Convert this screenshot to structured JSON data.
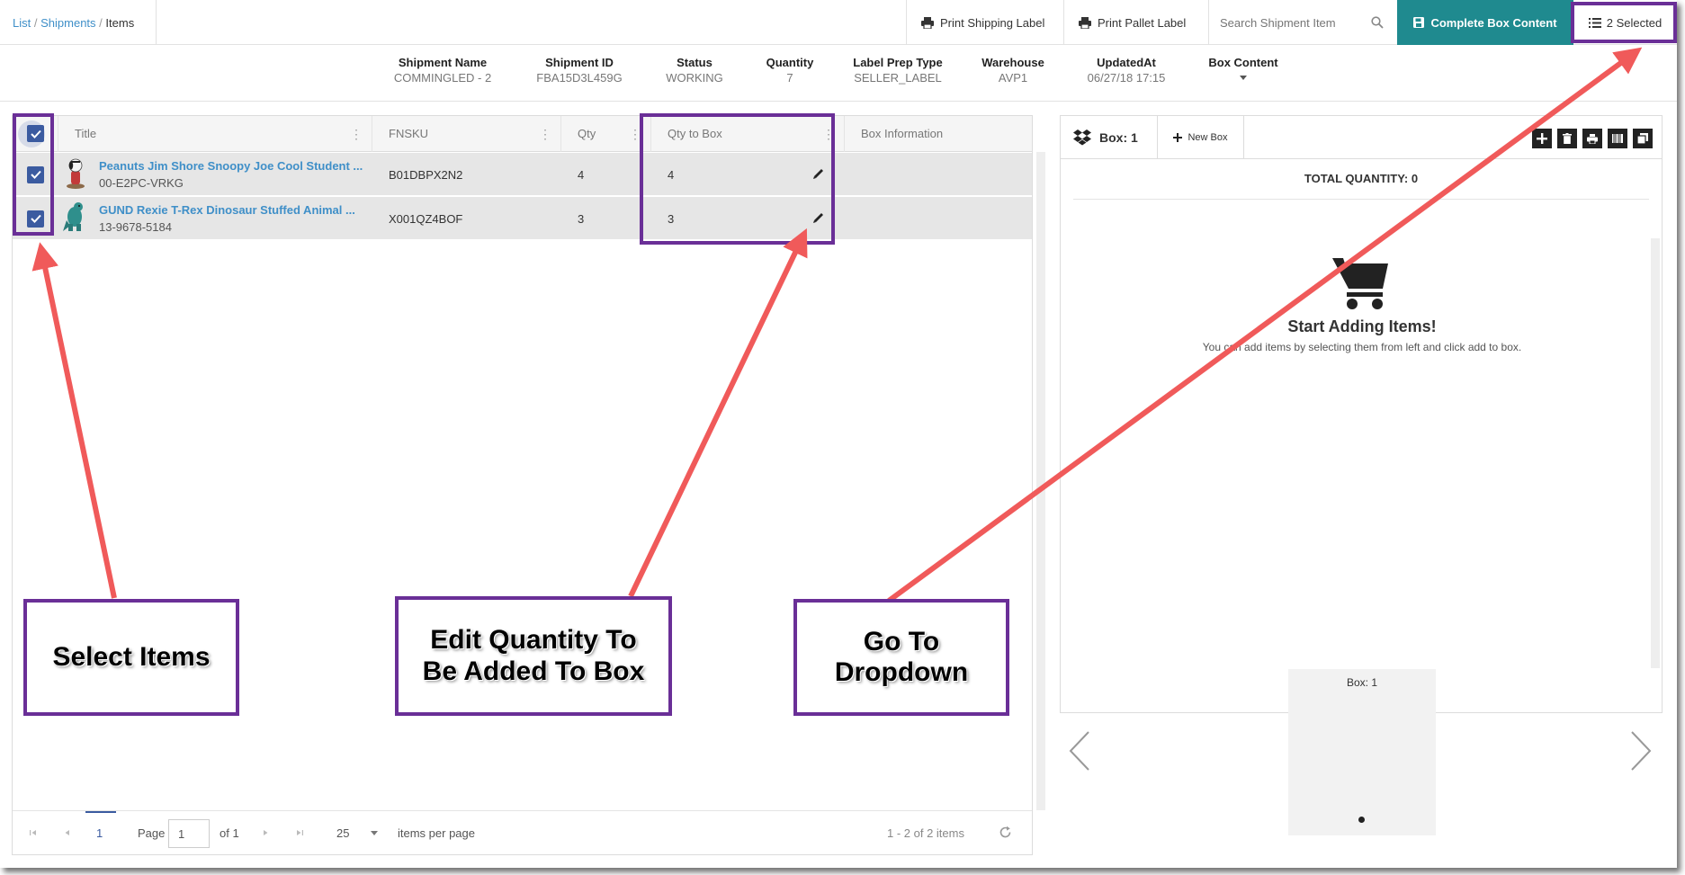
{
  "breadcrumb": {
    "list": "List",
    "sep": "/",
    "shipments": "Shipments",
    "current": "Items"
  },
  "toolbar": {
    "print_shipping": "Print Shipping Label",
    "print_pallet": "Print Pallet Label",
    "search_placeholder": "Search Shipment Item",
    "complete_box": "Complete Box Content",
    "selected": "2 Selected"
  },
  "shipment": {
    "fields": [
      {
        "label": "Shipment Name",
        "value": "COMMINGLED - 2"
      },
      {
        "label": "Shipment ID",
        "value": "FBA15D3L459G"
      },
      {
        "label": "Status",
        "value": "WORKING"
      },
      {
        "label": "Quantity",
        "value": "7"
      },
      {
        "label": "Label Prep Type",
        "value": "SELLER_LABEL"
      },
      {
        "label": "Warehouse",
        "value": "AVP1"
      },
      {
        "label": "UpdatedAt",
        "value": "06/27/18 17:15"
      },
      {
        "label": "Box Content",
        "value": ""
      }
    ]
  },
  "grid": {
    "columns": [
      "Title",
      "FNSKU",
      "Qty",
      "Qty to Box",
      "Box Information"
    ],
    "rows": [
      {
        "title": "Peanuts Jim Shore Snoopy Joe Cool Student ...",
        "sku": "00-E2PC-VRKG",
        "fnsku": "B01DBPX2N2",
        "qty": "4",
        "qty_to_box": "4",
        "box_info": ""
      },
      {
        "title": "GUND Rexie T-Rex Dinosaur Stuffed Animal ...",
        "sku": "13-9678-5184",
        "fnsku": "X001QZ4BOF",
        "qty": "3",
        "qty_to_box": "3",
        "box_info": ""
      }
    ]
  },
  "pager": {
    "current_page": "1",
    "page_label": "Page",
    "page_value": "1",
    "of_label": "of 1",
    "per_page": "25",
    "per_page_label": "items per page",
    "summary": "1 - 2 of 2 items"
  },
  "box_panel": {
    "tab_label": "Box: 1",
    "new_box": "New Box",
    "total": "TOTAL QUANTITY: 0",
    "empty_title": "Start Adding Items!",
    "empty_sub": "You can add items by selecting them from left and click add to box.",
    "carousel_label": "Box: 1"
  },
  "annotations": {
    "select_items": "Select Items",
    "edit_qty_line1": "Edit Quantity To",
    "edit_qty_line2": "Be Added To Box",
    "go_dropdown_line1": "Go To",
    "go_dropdown_line2": "Dropdown",
    "color_box": "#6a2f97",
    "color_arrow": "#f05a5a"
  },
  "colors": {
    "accent_teal": "#1f8a8f",
    "link_blue": "#3f8fc8",
    "checkbox_blue": "#3b5ba0"
  }
}
